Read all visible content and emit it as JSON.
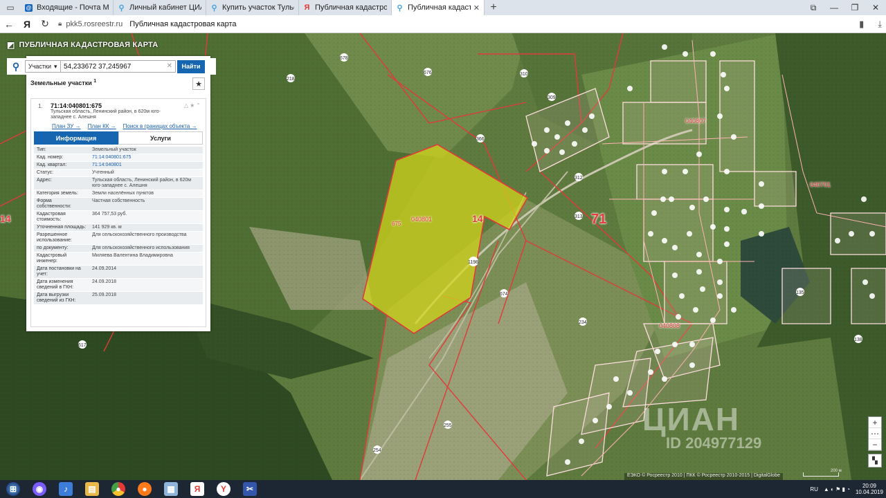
{
  "browser": {
    "tabs": [
      {
        "label": "Входящие - Почта Mail.Ru",
        "icon": "mail-icon",
        "color": "#1565c0"
      },
      {
        "label": "Личный кабинет ЦИАН",
        "icon": "pin-icon",
        "color": "#4aa3df"
      },
      {
        "label": "Купить участок Тульская о",
        "icon": "pin-icon",
        "color": "#4aa3df"
      },
      {
        "label": "Публичная кадастровая ка",
        "icon": "yandex-icon",
        "color": "#e53935"
      },
      {
        "label": "Публичная кадастровая",
        "icon": "pin-icon",
        "color": "#4aa3df",
        "active": true
      }
    ],
    "address": {
      "host": "pkk5.rosreestr.ru",
      "title": "Публичная кадастровая карта",
      "home": "Я"
    }
  },
  "app": {
    "title": "ПУБЛИЧНАЯ КАДАСТРОВАЯ КАРТА",
    "search": {
      "type": "Участки",
      "value": "54,233672 37,245967",
      "button": "Найти"
    },
    "results": {
      "heading": "Земельные участки",
      "count": "1"
    },
    "card": {
      "num": "1.",
      "id": "71:14:040801:675",
      "address": "Тульская область, Ленинский район, в 620м юго-западнее с. Алешня",
      "links": [
        "План ЗУ →",
        "План КК →",
        "Поиск в границах объекта →"
      ],
      "tabs": [
        "Информация",
        "Услуги"
      ],
      "fields": [
        {
          "k": "Тип:",
          "v": "Земельный участок"
        },
        {
          "k": "Кад. номер:",
          "v": "71:14:040801:675",
          "link": true
        },
        {
          "k": "Кад. квартал:",
          "v": "71:14:040801",
          "link": true
        },
        {
          "k": "Статус:",
          "v": "Учтенный"
        },
        {
          "k": "Адрес:",
          "v": "Тульская область, Ленинский район, в 620м юго-западнее с. Алешня"
        },
        {
          "k": "Категория земель:",
          "v": "Земли населённых пунктов"
        },
        {
          "k": "Форма собственности:",
          "v": "Частная собственность"
        },
        {
          "k": "Кадастровая стоимость:",
          "v": "364 757,53 руб."
        },
        {
          "k": "Уточненная площадь:",
          "v": "141 929 кв. м"
        },
        {
          "k": "Разрешенное использование:",
          "v": "Для сельскохозяйственного производства"
        },
        {
          "k": "по документу:",
          "v": "Для сельскохозяйственного использования"
        },
        {
          "k": "Кадастровый инженер:",
          "v": "Миляева Валентина Владимировна"
        },
        {
          "k": "Дата постановки на учет:",
          "v": "24.09.2014"
        },
        {
          "k": "Дата изменения сведений в ГКН:",
          "v": "24.09.2018"
        },
        {
          "k": "Дата выгрузки сведений из ГКН:",
          "v": "25.09.2018"
        }
      ]
    },
    "map": {
      "labels": {
        "region": "71",
        "district": "14",
        "district_left": "14",
        "parcel_quarter": "040801",
        "parcel_num": "675",
        "q1": "040807",
        "q2": "040701",
        "q3": "040808",
        "plots": [
          "678",
          "676",
          "218",
          "310",
          "309",
          "366",
          "312",
          "313",
          "674",
          "234",
          "1198",
          "617",
          "255",
          "254",
          "138",
          "135"
        ]
      },
      "attribution": "ЕЭКО © Росреестр 2010 | ПКК © Росреестр 2010-2015 | DigitalGlobe",
      "scale": "200 м",
      "zoom_in": "+",
      "zoom_out": "−",
      "watermark": {
        "brand": "ЦИАН",
        "id": "ID 204977129"
      }
    }
  },
  "taskbar": {
    "lang": "RU",
    "time": "20:09",
    "date": "10.04.2019"
  }
}
